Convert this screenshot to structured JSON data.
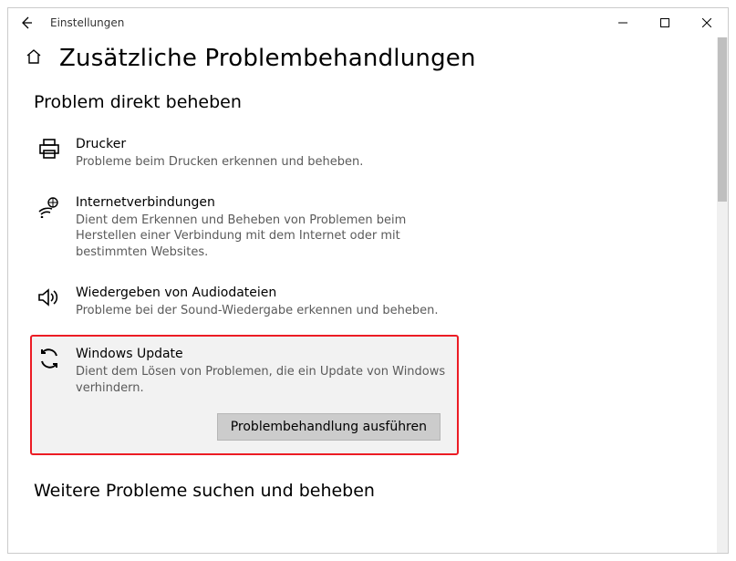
{
  "window": {
    "title": "Einstellungen"
  },
  "page": {
    "title": "Zusätzliche Problembehandlungen"
  },
  "sections": {
    "direct": {
      "title": "Problem direkt beheben"
    },
    "more": {
      "title": "Weitere Probleme suchen und beheben"
    }
  },
  "items": [
    {
      "title": "Drucker",
      "desc": "Probleme beim Drucken erkennen und beheben."
    },
    {
      "title": "Internetverbindungen",
      "desc": "Dient dem Erkennen und Beheben von Problemen beim Herstellen einer Verbindung mit dem Internet oder mit bestimmten Websites."
    },
    {
      "title": "Wiedergeben von Audiodateien",
      "desc": "Probleme bei der Sound-Wiedergabe erkennen und beheben."
    },
    {
      "title": "Windows Update",
      "desc": "Dient dem Lösen von Problemen, die ein Update von Windows verhindern."
    }
  ],
  "actions": {
    "run": "Problembehandlung ausführen"
  }
}
